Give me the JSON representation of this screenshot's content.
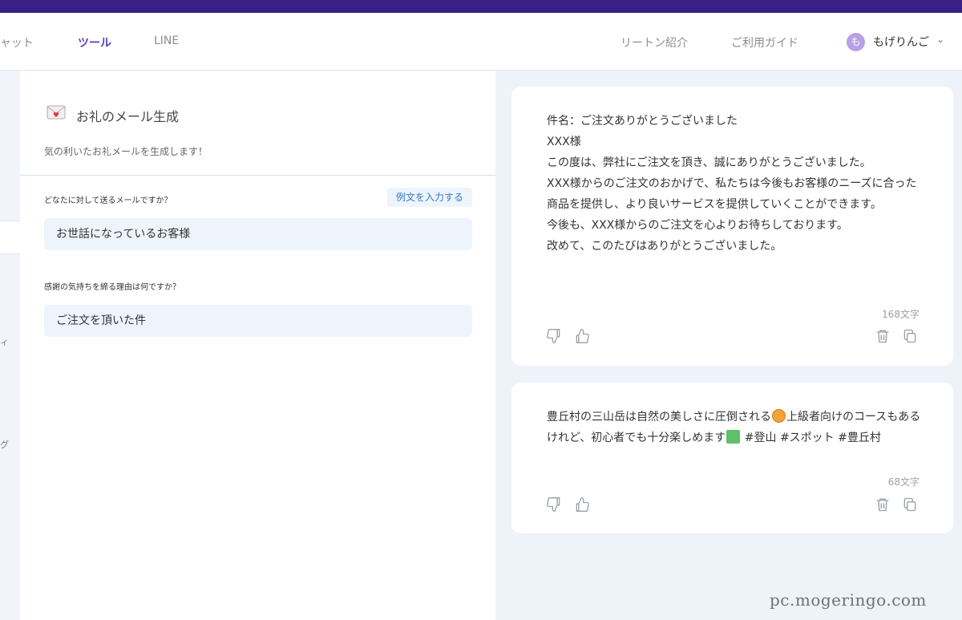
{
  "nav": {
    "items": [
      "チャット",
      "ツール",
      "LINE"
    ],
    "right_items": [
      "リートン紹介",
      "ご利用ガイド"
    ],
    "avatar_letter": "も",
    "username": "もげりんご",
    "caret": "⌄"
  },
  "sidebar_fragments": [
    "ィ",
    "グ"
  ],
  "tool": {
    "icon": "envelope-heart-icon",
    "title": "お礼のメール生成",
    "description": "気の利いたお礼メールを生成します！",
    "q1_label": "どなたに対して送るメールですか？",
    "example_button": "例文を入力する",
    "q1_value": "お世話になっているお客様",
    "q2_label": "感謝の気持ちを締る理由は何ですか？",
    "q2_value": "ご注文を頂いた件"
  },
  "results": [
    {
      "lines": [
        "件名：ご注文ありがとうございました",
        "XXX様",
        "この度は、弊社にご注文を頂き、誠にありがとうございました。",
        "XXX様からのご注文のおかげで、私たちは今後もお客様のニーズに合った商品を提供し、より良いサービスを提供していくことができます。",
        "今後も、XXX様からのご注文を心よりお待ちしております。",
        "改めて、このたびはありがとうございました。"
      ],
      "count": "168文字"
    },
    {
      "text_a": "豊丘村の三山岳は自然の美しさに圧倒される",
      "text_b": "上級者向けのコースもあるけれど、初心者でも十分楽しめます",
      "text_c": " #登山 #スポット #豊丘村",
      "count": "68文字"
    }
  ],
  "watermark": "pc.mogeringo.com",
  "colors": {
    "topbar": "#3a1f86",
    "accent": "#5b3fc0",
    "input_bg": "#eef4fc",
    "page_bg": "#eef3fa"
  }
}
